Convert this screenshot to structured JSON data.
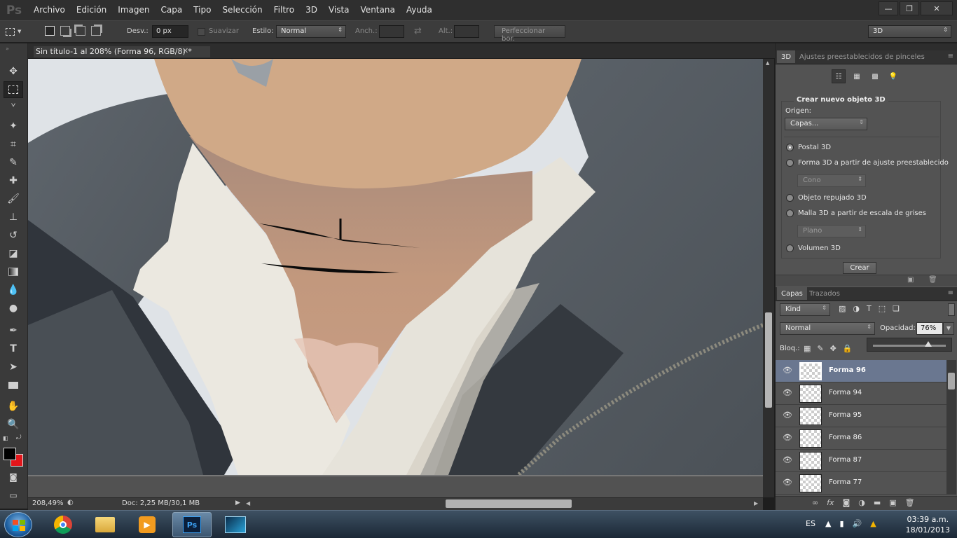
{
  "app": {
    "logo": "Ps"
  },
  "menubar": {
    "items": [
      "Archivo",
      "Edición",
      "Imagen",
      "Capa",
      "Tipo",
      "Selección",
      "Filtro",
      "3D",
      "Vista",
      "Ventana",
      "Ayuda"
    ]
  },
  "window_controls": {
    "minimize": "—",
    "restore": "❐",
    "close": "✕"
  },
  "options_bar": {
    "feather_label": "Desv.:",
    "feather_value": "0 px",
    "antialias_label": "Suavizar",
    "style_label": "Estilo:",
    "style_value": "Normal",
    "width_label": "Anch.:",
    "height_label": "Alt.:",
    "refine_button": "Perfeccionar bor.",
    "workspace_value": "3D"
  },
  "document": {
    "tab_title": "Sin título-1 al 208% (Forma 96, RGB/8) *",
    "zoom": "208,49%",
    "doc_info": "Doc: 2,25 MB/30,1 MB"
  },
  "panel_3d": {
    "tabs": [
      "3D",
      "Ajustes preestablecidos de pinceles"
    ],
    "section_title": "Crear nuevo objeto 3D",
    "origin_label": "Origen:",
    "origin_value": "Capas...",
    "options": [
      {
        "label": "Postal 3D",
        "selected": true
      },
      {
        "label": "Forma 3D a partir de ajuste preestablecido",
        "selected": false
      },
      {
        "label": "Objeto repujado 3D",
        "selected": false
      },
      {
        "label": "Malla 3D a partir de escala de grises",
        "selected": false
      },
      {
        "label": "Volumen 3D",
        "selected": false
      }
    ],
    "preset_shape": "Cono",
    "mesh_shape": "Plano",
    "create_button": "Crear"
  },
  "layers_panel": {
    "tabs": [
      "Capas",
      "Trazados"
    ],
    "filter_value": "Kind",
    "blend_mode": "Normal",
    "opacity_label": "Opacidad:",
    "opacity_value": "76%",
    "opacity_fraction": 0.76,
    "lock_label": "Bloq.:",
    "layers": [
      {
        "name": "Forma 96",
        "selected": true
      },
      {
        "name": "Forma 94",
        "selected": false
      },
      {
        "name": "Forma 95",
        "selected": false
      },
      {
        "name": "Forma 86",
        "selected": false
      },
      {
        "name": "Forma 87",
        "selected": false
      },
      {
        "name": "Forma 77",
        "selected": false
      }
    ]
  },
  "taskbar": {
    "language": "ES",
    "time": "03:39 a.m.",
    "date": "18/01/2013"
  },
  "colors": {
    "foreground": "#000000",
    "background": "#e3161b",
    "selected_layer": "#6a7790",
    "skin": "#c99e80",
    "jacket": "#5a6168",
    "shirt": "#e9e6dd"
  }
}
